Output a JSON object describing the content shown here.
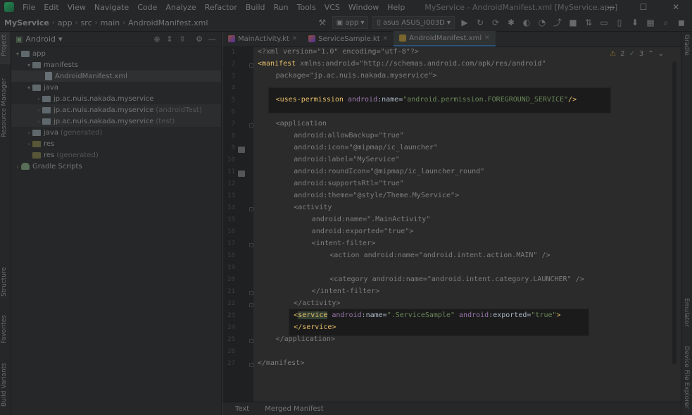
{
  "window": {
    "title": "MyService - AndroidManifest.xml [MyService.app]",
    "controls": {
      "minimize": "—",
      "maximize": "☐",
      "close": "✕"
    }
  },
  "menu": [
    "File",
    "Edit",
    "View",
    "Navigate",
    "Code",
    "Analyze",
    "Refactor",
    "Build",
    "Run",
    "Tools",
    "VCS",
    "Window",
    "Help"
  ],
  "breadcrumb": [
    "MyService",
    "app",
    "src",
    "main",
    "AndroidManifest.xml"
  ],
  "toolbar": {
    "run_config": "app",
    "device": "asus ASUS_I003D"
  },
  "left_tool_tabs": [
    "Project",
    "Resource Manager",
    "Structure",
    "Favorites",
    "Build Variants"
  ],
  "right_tool_tabs": [
    "Gradle",
    "Emulator",
    "Device File Explorer"
  ],
  "project_panel": {
    "view": "Android",
    "tree": [
      {
        "label": "app",
        "extra": ""
      },
      {
        "label": "manifests",
        "extra": ""
      },
      {
        "label": "AndroidManifest.xml",
        "extra": ""
      },
      {
        "label": "java",
        "extra": ""
      },
      {
        "label": "jp.ac.nuis.nakada.myservice",
        "extra": ""
      },
      {
        "label": "jp.ac.nuis.nakada.myservice",
        "extra": "(androidTest)"
      },
      {
        "label": "jp.ac.nuis.nakada.myservice",
        "extra": "(test)"
      },
      {
        "label": "java",
        "extra": "(generated)"
      },
      {
        "label": "res",
        "extra": ""
      },
      {
        "label": "res",
        "extra": "(generated)"
      },
      {
        "label": "Gradle Scripts",
        "extra": ""
      }
    ]
  },
  "editor_tabs": [
    {
      "label": "MainActivity.kt"
    },
    {
      "label": "ServiceSample.kt"
    },
    {
      "label": "AndroidManifest.xml"
    }
  ],
  "inspections": {
    "warnings": "2",
    "weak_warnings": "3"
  },
  "line_numbers": [
    "1",
    "2",
    "3",
    "4",
    "5",
    "6",
    "7",
    "8",
    "9",
    "10",
    "11",
    "12",
    "13",
    "14",
    "15",
    "16",
    "17",
    "18",
    "19",
    "20",
    "21",
    "22",
    "23",
    "24",
    "25",
    "26",
    "27"
  ],
  "code": {
    "l1": [
      "<?xml version=\"1.0\" encoding=\"utf-8\"?>"
    ],
    "l2": [
      "<manifest",
      " xmlns:",
      "android",
      "=",
      "\"http://schemas.android.com/apk/res/android\""
    ],
    "l3": [
      "package",
      "=",
      "\"jp.ac.nuis.nakada.myservice\"",
      ">"
    ],
    "l5": [
      "<uses-permission",
      " android",
      ":name",
      "=",
      "\"android.permission.FOREGROUND_SERVICE\"",
      "/>"
    ],
    "l7": [
      "<application"
    ],
    "l8": [
      "android",
      ":allowBackup",
      "=",
      "\"true\""
    ],
    "l9": [
      "android",
      ":icon",
      "=",
      "\"@mipmap/ic_launcher\""
    ],
    "l10": [
      "android",
      ":label",
      "=",
      "\"MyService\""
    ],
    "l11": [
      "android",
      ":roundIcon",
      "=",
      "\"@mipmap/ic_launcher_round\""
    ],
    "l12": [
      "android",
      ":supportsRtl",
      "=",
      "\"true\""
    ],
    "l13": [
      "android",
      ":theme",
      "=",
      "\"@style/Theme.MyService\"",
      ">"
    ],
    "l14": [
      "<activity"
    ],
    "l15": [
      "android",
      ":name",
      "=",
      "\".MainActivity\""
    ],
    "l16": [
      "android",
      ":exported",
      "=",
      "\"true\"",
      ">"
    ],
    "l17": [
      "<intent-filter>"
    ],
    "l18": [
      "<action",
      " android",
      ":name",
      "=",
      "\"android.intent.action.MAIN\"",
      " />"
    ],
    "l20": [
      "<category",
      " android",
      ":name",
      "=",
      "\"android.intent.category.LAUNCHER\"",
      " />"
    ],
    "l21": [
      "</intent-filter>"
    ],
    "l22": [
      "</activity>"
    ],
    "l23": [
      "<",
      "service",
      " android",
      ":name",
      "=",
      "\".ServiceSample\"",
      " android",
      ":exported",
      "=",
      "\"true\"",
      ">"
    ],
    "l24": [
      "</service>"
    ],
    "l25": [
      "</application>"
    ],
    "l27": [
      "</manifest>"
    ]
  },
  "bottom_tabs": [
    "Text",
    "Merged Manifest"
  ]
}
